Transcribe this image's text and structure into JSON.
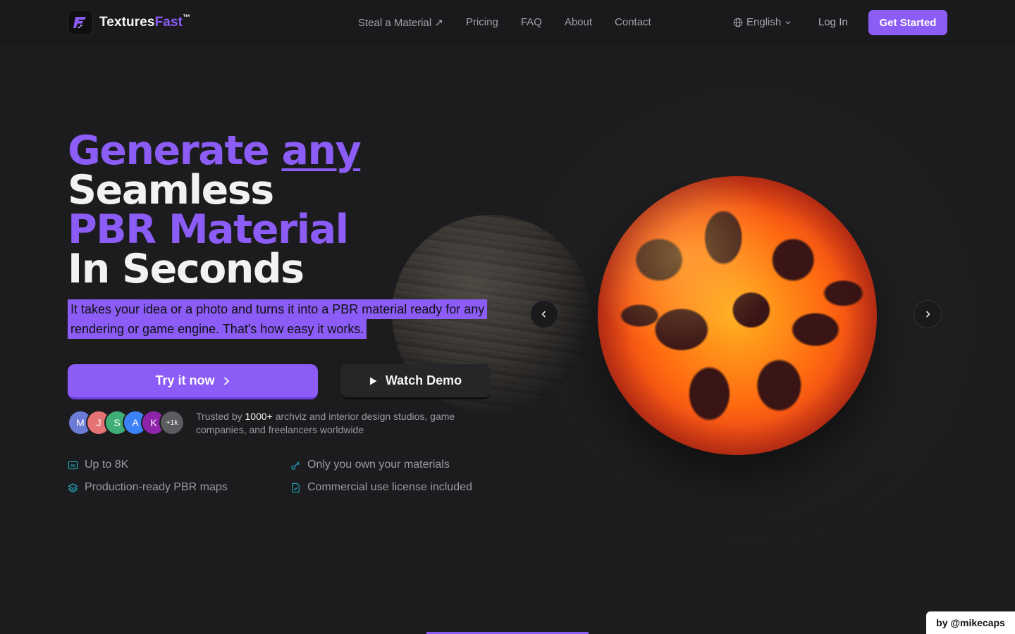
{
  "brand": {
    "name_main": "Textures",
    "name_accent": "Fast",
    "trademark": "™"
  },
  "nav": {
    "links": [
      "Steal a Material ↗",
      "Pricing",
      "FAQ",
      "About",
      "Contact"
    ],
    "language": "English",
    "login": "Log In",
    "cta": "Get Started"
  },
  "hero": {
    "line1_a": "Generate",
    "line1_b": "any",
    "line2": "Seamless",
    "line3": "PBR Material",
    "line4": "In Seconds",
    "subtext": "It takes your idea or a photo and turns it into a PBR material ready for any rendering or game engine. That's how easy it works.",
    "try_label": "Try it now",
    "demo_label": "Watch Demo"
  },
  "social_proof": {
    "avatars": [
      {
        "initial": "M",
        "color": "#6b7bd6"
      },
      {
        "initial": "J",
        "color": "#e57373"
      },
      {
        "initial": "S",
        "color": "#3fae74"
      },
      {
        "initial": "A",
        "color": "#3b82f6"
      },
      {
        "initial": "K",
        "color": "#8e24aa"
      }
    ],
    "more": "+1k",
    "trusted_prefix": "Trusted by ",
    "trusted_count": "1000+",
    "trusted_suffix": " archviz and interior design studios, game companies, and freelancers worldwide"
  },
  "features": [
    {
      "label": "Up to 8K",
      "icon": "8k-icon"
    },
    {
      "label": "Only you own your materials",
      "icon": "key-icon"
    },
    {
      "label": "Production-ready PBR maps",
      "icon": "layers-icon"
    },
    {
      "label": "Commercial use license included",
      "icon": "document-icon"
    }
  ],
  "colors": {
    "accent": "#8b5cf6",
    "background": "#1c1c1e",
    "feature_icon": "#22b8cf"
  },
  "credit": "by @mikecaps"
}
